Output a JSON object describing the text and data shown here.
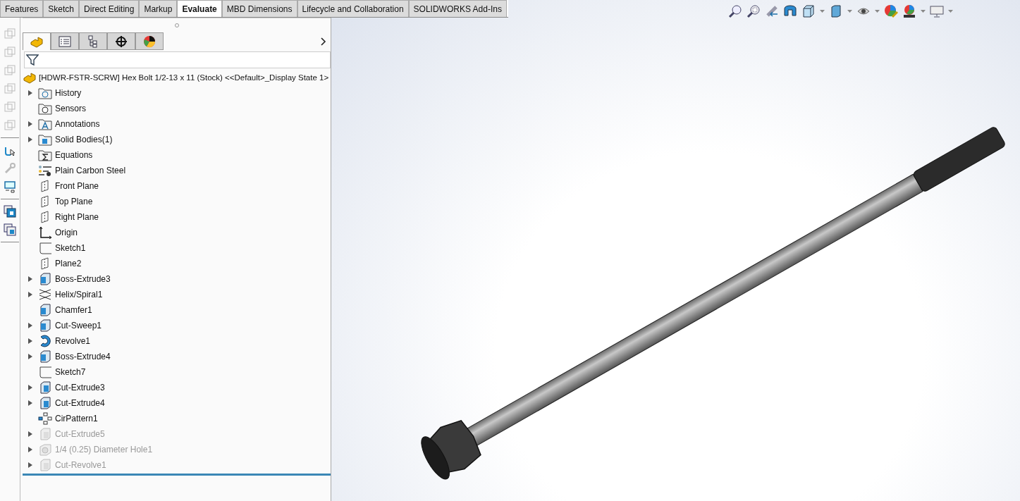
{
  "command_tabs": [
    {
      "label": "Features",
      "selected": false
    },
    {
      "label": "Sketch",
      "selected": false
    },
    {
      "label": "Direct Editing",
      "selected": false
    },
    {
      "label": "Markup",
      "selected": false
    },
    {
      "label": "Evaluate",
      "selected": true
    },
    {
      "label": "MBD Dimensions",
      "selected": false
    },
    {
      "label": "Lifecycle and Collaboration",
      "selected": false
    },
    {
      "label": "SOLIDWORKS Add-Ins",
      "selected": false
    }
  ],
  "panel_tabs": [
    {
      "kind": "feature-tree",
      "selected": true
    },
    {
      "kind": "property",
      "selected": false
    },
    {
      "kind": "config",
      "selected": false
    },
    {
      "kind": "dim",
      "selected": false
    },
    {
      "kind": "display",
      "selected": false
    }
  ],
  "tree": {
    "root": "[HDWR-FSTR-SCRW] Hex Bolt 1/2-13 x 11 (Stock) <<Default>_Display State 1>",
    "items": [
      {
        "label": "History",
        "kind": "history",
        "expandable": true,
        "suppressed": false
      },
      {
        "label": "Sensors",
        "kind": "sensor",
        "expandable": false,
        "suppressed": false
      },
      {
        "label": "Annotations",
        "kind": "annotation",
        "expandable": true,
        "suppressed": false
      },
      {
        "label": "Solid Bodies(1)",
        "kind": "bodies",
        "expandable": true,
        "suppressed": false
      },
      {
        "label": "Equations",
        "kind": "equation",
        "expandable": false,
        "suppressed": false
      },
      {
        "label": "Plain Carbon Steel",
        "kind": "material",
        "expandable": false,
        "suppressed": false
      },
      {
        "label": "Front Plane",
        "kind": "plane",
        "expandable": false,
        "suppressed": false
      },
      {
        "label": "Top Plane",
        "kind": "plane",
        "expandable": false,
        "suppressed": false
      },
      {
        "label": "Right Plane",
        "kind": "plane",
        "expandable": false,
        "suppressed": false
      },
      {
        "label": "Origin",
        "kind": "origin",
        "expandable": false,
        "suppressed": false
      },
      {
        "label": "Sketch1",
        "kind": "sketch",
        "expandable": false,
        "suppressed": false
      },
      {
        "label": "Plane2",
        "kind": "plane",
        "expandable": false,
        "suppressed": false
      },
      {
        "label": "Boss-Extrude3",
        "kind": "extrude",
        "expandable": true,
        "suppressed": false
      },
      {
        "label": "Helix/Spiral1",
        "kind": "helix",
        "expandable": true,
        "suppressed": false
      },
      {
        "label": "Chamfer1",
        "kind": "chamfer",
        "expandable": false,
        "suppressed": false
      },
      {
        "label": "Cut-Sweep1",
        "kind": "sweep",
        "expandable": true,
        "suppressed": false
      },
      {
        "label": "Revolve1",
        "kind": "revolve",
        "expandable": true,
        "suppressed": false
      },
      {
        "label": "Boss-Extrude4",
        "kind": "extrude",
        "expandable": true,
        "suppressed": false
      },
      {
        "label": "Sketch7",
        "kind": "sketch",
        "expandable": false,
        "suppressed": false
      },
      {
        "label": "Cut-Extrude3",
        "kind": "cut",
        "expandable": true,
        "suppressed": false
      },
      {
        "label": "Cut-Extrude4",
        "kind": "cut",
        "expandable": true,
        "suppressed": false
      },
      {
        "label": "CirPattern1",
        "kind": "pattern",
        "expandable": false,
        "suppressed": false
      },
      {
        "label": "Cut-Extrude5",
        "kind": "cut",
        "expandable": true,
        "suppressed": true
      },
      {
        "label": "1/4 (0.25) Diameter Hole1",
        "kind": "hole",
        "expandable": true,
        "suppressed": true
      },
      {
        "label": "Cut-Revolve1",
        "kind": "cut",
        "expandable": true,
        "suppressed": true
      }
    ]
  }
}
